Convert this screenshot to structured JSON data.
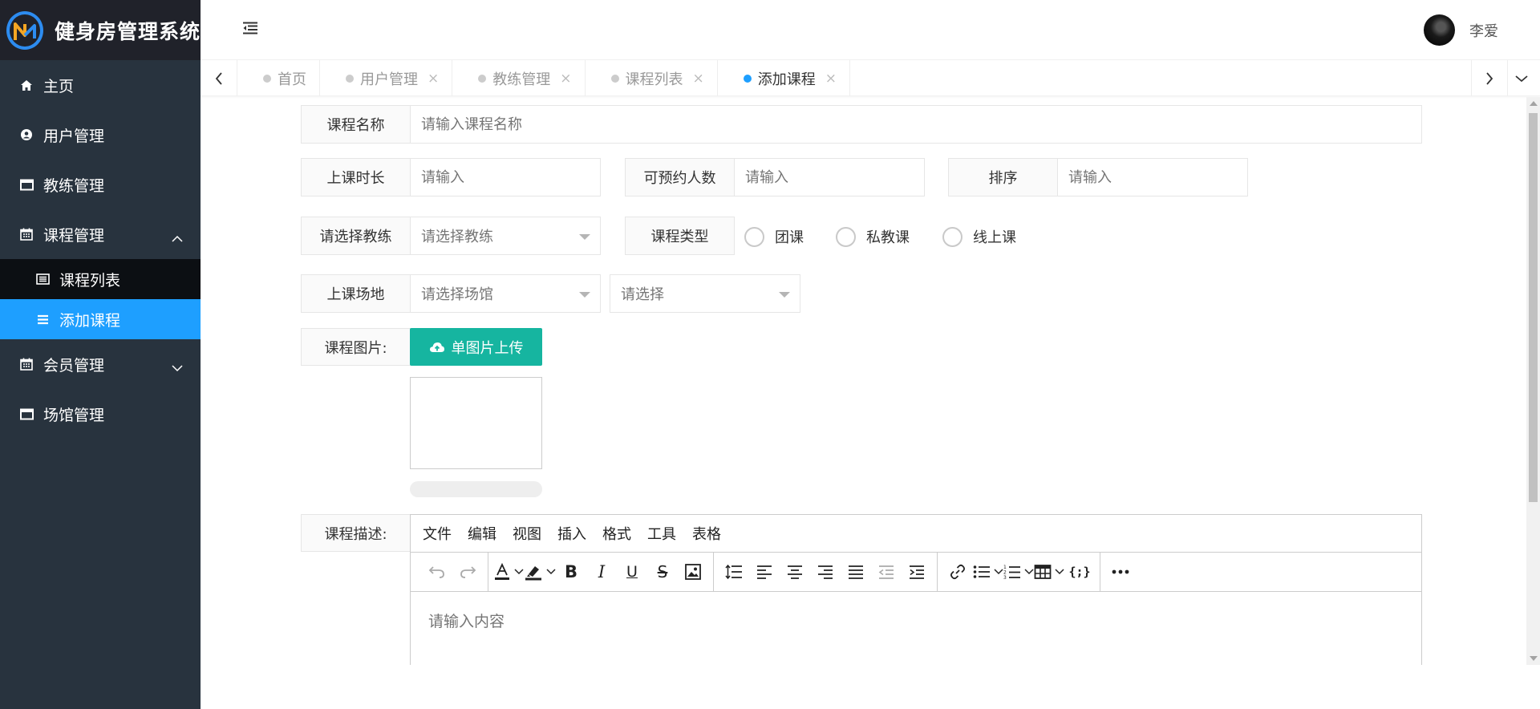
{
  "app": {
    "title": "健身房管理系统"
  },
  "sidebar": {
    "items": [
      {
        "label": "主页",
        "icon": "home-icon"
      },
      {
        "label": "用户管理",
        "icon": "user-circle-icon"
      },
      {
        "label": "教练管理",
        "icon": "window-icon"
      },
      {
        "label": "课程管理",
        "icon": "calendar-icon",
        "expanded": true,
        "children": [
          {
            "label": "课程列表",
            "icon": "list-alt-icon"
          },
          {
            "label": "添加课程",
            "icon": "bars-icon",
            "active": true
          }
        ]
      },
      {
        "label": "会员管理",
        "icon": "calendar-icon"
      },
      {
        "label": "场馆管理",
        "icon": "window-icon"
      }
    ]
  },
  "header": {
    "user_name": "李爱"
  },
  "tabs": [
    {
      "label": "首页",
      "closable": false
    },
    {
      "label": "用户管理",
      "closable": true
    },
    {
      "label": "教练管理",
      "closable": true
    },
    {
      "label": "课程列表",
      "closable": true
    },
    {
      "label": "添加课程",
      "closable": true,
      "active": true
    }
  ],
  "form": {
    "course_name": {
      "label": "课程名称",
      "placeholder": "请输入课程名称"
    },
    "duration": {
      "label": "上课时长",
      "placeholder": "请输入"
    },
    "capacity": {
      "label": "可预约人数",
      "placeholder": "请输入"
    },
    "sort": {
      "label": "排序",
      "placeholder": "请输入"
    },
    "coach": {
      "label": "请选择教练",
      "placeholder": "请选择教练"
    },
    "course_type": {
      "label": "课程类型",
      "options": [
        "团课",
        "私教课",
        "线上课"
      ]
    },
    "venue": {
      "label": "上课场地",
      "placeholder": "请选择场馆",
      "sub_placeholder": "请选择"
    },
    "image": {
      "label": "课程图片:",
      "upload_label": "单图片上传",
      "progress": 0
    },
    "description": {
      "label": "课程描述:",
      "menus": [
        "文件",
        "编辑",
        "视图",
        "插入",
        "格式",
        "工具",
        "表格"
      ],
      "placeholder": "请输入内容"
    }
  },
  "colors": {
    "accent": "#1e9fff",
    "upload": "#16b5a0",
    "sidebar": "#28333e"
  }
}
